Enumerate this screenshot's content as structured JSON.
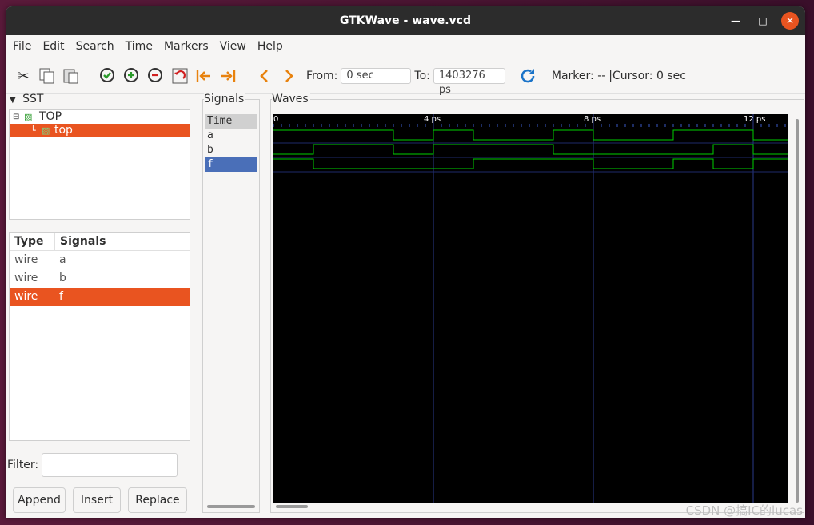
{
  "window": {
    "title": "GTKWave - wave.vcd"
  },
  "menu": [
    "File",
    "Edit",
    "Search",
    "Time",
    "Markers",
    "View",
    "Help"
  ],
  "toolbar": {
    "from_label": "From:",
    "from_value": "0 sec",
    "to_label": "To:",
    "to_value": "1403276 ps",
    "marker_label": "Marker: -- ",
    "cursor_sep": "|",
    "cursor_label": " Cursor: 0 sec"
  },
  "sst": {
    "title": "SST",
    "tree": [
      {
        "label": "TOP",
        "selected": false
      },
      {
        "label": "top",
        "selected": true
      }
    ]
  },
  "signals_table": {
    "headers": [
      "Type",
      "Signals"
    ],
    "rows": [
      {
        "type": "wire",
        "name": "a",
        "selected": false
      },
      {
        "type": "wire",
        "name": "b",
        "selected": false
      },
      {
        "type": "wire",
        "name": "f",
        "selected": true
      }
    ]
  },
  "filter": {
    "label": "Filter:"
  },
  "buttons": {
    "append": "Append",
    "insert": "Insert",
    "replace": "Replace"
  },
  "signals_pane": {
    "title": "Signals",
    "items": [
      "Time",
      "a",
      "b",
      "f"
    ]
  },
  "waves": {
    "title": "Waves",
    "time_labels": [
      "0",
      "4 ps",
      "8 ps",
      "12 ps"
    ],
    "wave_color": "#00d000",
    "grid_color": "#2a3a8a",
    "signals": {
      "a": [
        1,
        1,
        1,
        0,
        1,
        0,
        0,
        1,
        0,
        0,
        1,
        1,
        0
      ],
      "b": [
        0,
        1,
        1,
        0,
        1,
        1,
        1,
        0,
        0,
        0,
        0,
        1,
        0
      ],
      "f": [
        1,
        0,
        0,
        0,
        0,
        1,
        1,
        1,
        0,
        0,
        1,
        0,
        1
      ]
    }
  },
  "watermark": "CSDN @搞IC的lucas"
}
